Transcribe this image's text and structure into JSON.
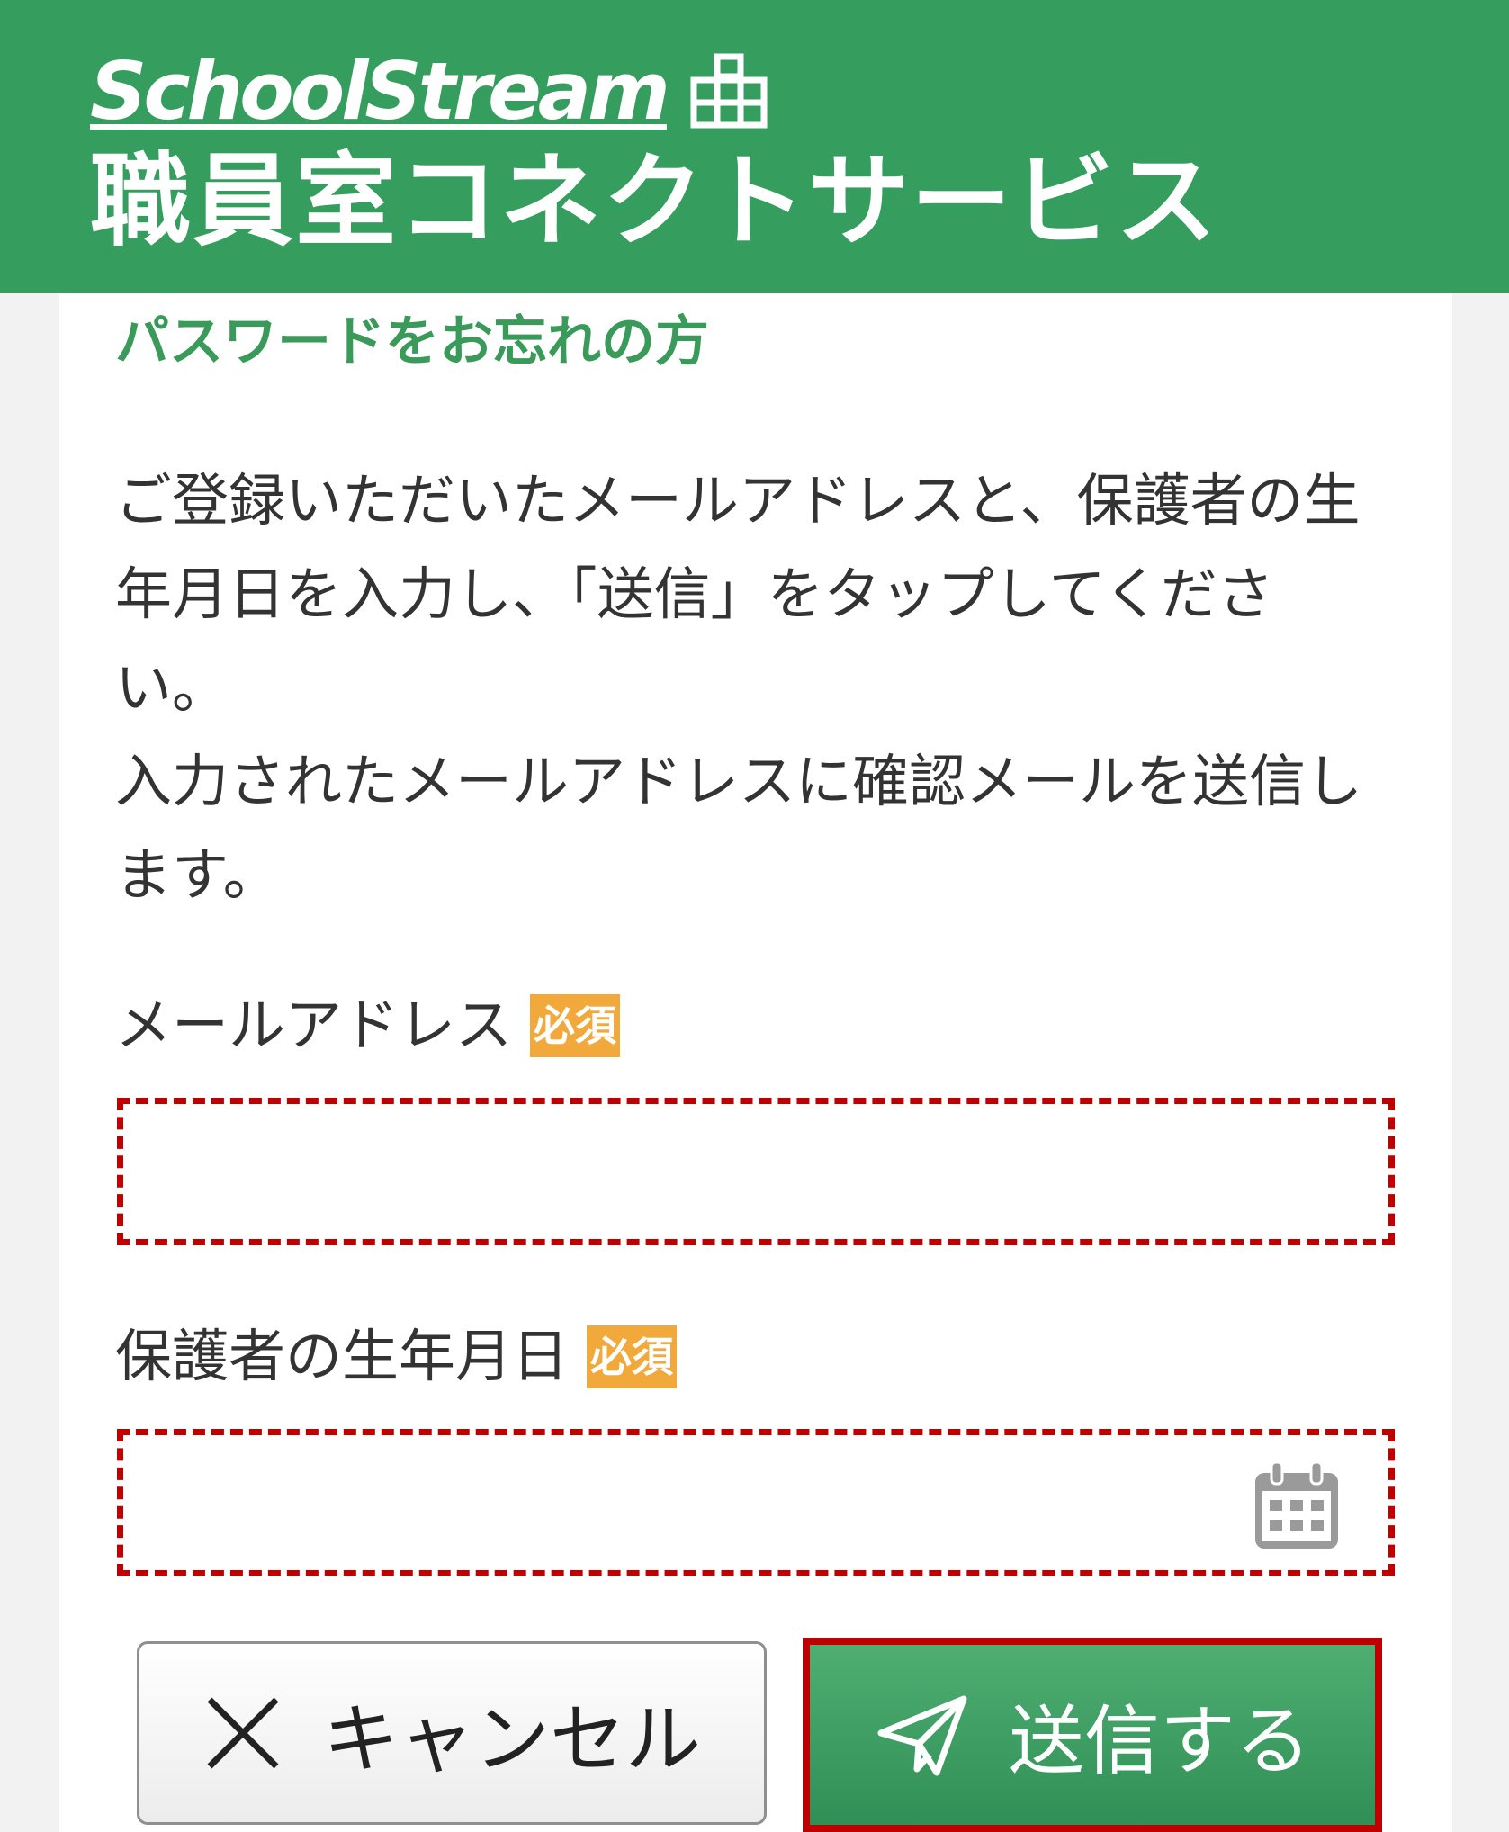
{
  "header": {
    "brand": "SchoolStream",
    "service_title": "職員室コネクトサービス",
    "background_color": "#359e5e",
    "icons": [
      "school-building-icon"
    ]
  },
  "main": {
    "heading": "パスワードをお忘れの方",
    "heading_color": "#3a9a5a",
    "description": [
      "ご登録いただいたメールアドレスと、保護者の生年月日を入力し、「送信」をタップしてください。",
      "入力されたメールアドレスに確認メールを送信します。"
    ]
  },
  "form": {
    "email": {
      "label": "メールアドレス",
      "required_badge": "必須",
      "value": ""
    },
    "birthdate": {
      "label": "保護者の生年月日",
      "required_badge": "必須",
      "value": "",
      "icon": "calendar-icon"
    },
    "required_badge_color": "#f2a93b",
    "highlight_color": "#c00000"
  },
  "actions": {
    "cancel_label": "キャンセル",
    "cancel_icon": "close-icon",
    "send_label": "送信する",
    "send_icon": "paper-plane-icon",
    "send_color": "#359e5e"
  }
}
